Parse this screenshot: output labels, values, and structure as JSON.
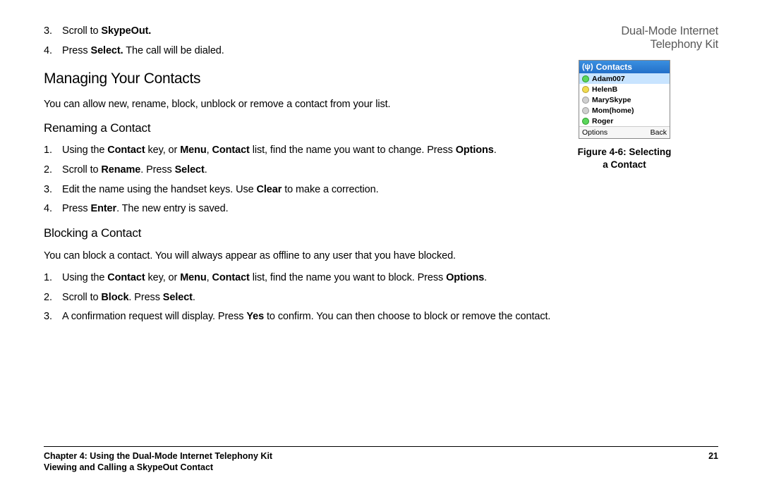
{
  "header": {
    "doc_title": "Dual-Mode Internet Telephony Kit"
  },
  "intro_steps": {
    "step3_pre": "Scroll to ",
    "step3_bold": "SkypeOut.",
    "step4_pre": "Press ",
    "step4_bold": "Select.",
    "step4_post": " The call will be dialed."
  },
  "section1": {
    "title": "Managing Your Contacts",
    "intro": "You can allow new, rename, block, unblock or remove a contact from your list."
  },
  "rename": {
    "title": "Renaming a Contact",
    "s1_a": "Using the ",
    "s1_b": "Contact",
    "s1_c": " key, or ",
    "s1_d": "Menu",
    "s1_e": ", ",
    "s1_f": "Contact",
    "s1_g": " list, find the name you want to change. Press ",
    "s1_h": "Options",
    "s1_i": ".",
    "s2_a": "Scroll to ",
    "s2_b": "Rename",
    "s2_c": ". Press ",
    "s2_d": "Select",
    "s2_e": ".",
    "s3_a": "Edit the name using the handset keys. Use ",
    "s3_b": "Clear",
    "s3_c": " to make a correction.",
    "s4_a": "Press ",
    "s4_b": "Enter",
    "s4_c": ". The new entry is saved."
  },
  "block": {
    "title": "Blocking a Contact",
    "intro": "You can block a contact. You will always appear as offline to any user that you have blocked.",
    "s1_a": "Using the ",
    "s1_b": "Contact",
    "s1_c": " key, or ",
    "s1_d": "Menu",
    "s1_e": ", ",
    "s1_f": "Contact",
    "s1_g": " list, find the name you want to block. Press ",
    "s1_h": "Options",
    "s1_i": ".",
    "s2_a": "Scroll to ",
    "s2_b": "Block",
    "s2_c": ". Press ",
    "s2_d": "Select",
    "s2_e": ".",
    "s3_a": "A confirmation request will display. Press ",
    "s3_b": "Yes",
    "s3_c": " to confirm. You can then choose to block or remove the contact."
  },
  "phone": {
    "titlebar": "Contacts",
    "contacts": {
      "c0": "Adam007",
      "c1": "HelenB",
      "c2": "MarySkype",
      "c3": "Mom(home)",
      "c4": "Roger"
    },
    "sk_left": "Options",
    "sk_right": "Back",
    "caption_line1": "Figure 4-6: Selecting",
    "caption_line2": "a Contact"
  },
  "footer": {
    "chapter": "Chapter 4: Using the Dual-Mode Internet Telephony Kit",
    "pagenum": "21",
    "subtitle": "Viewing and Calling a SkypeOut Contact"
  }
}
